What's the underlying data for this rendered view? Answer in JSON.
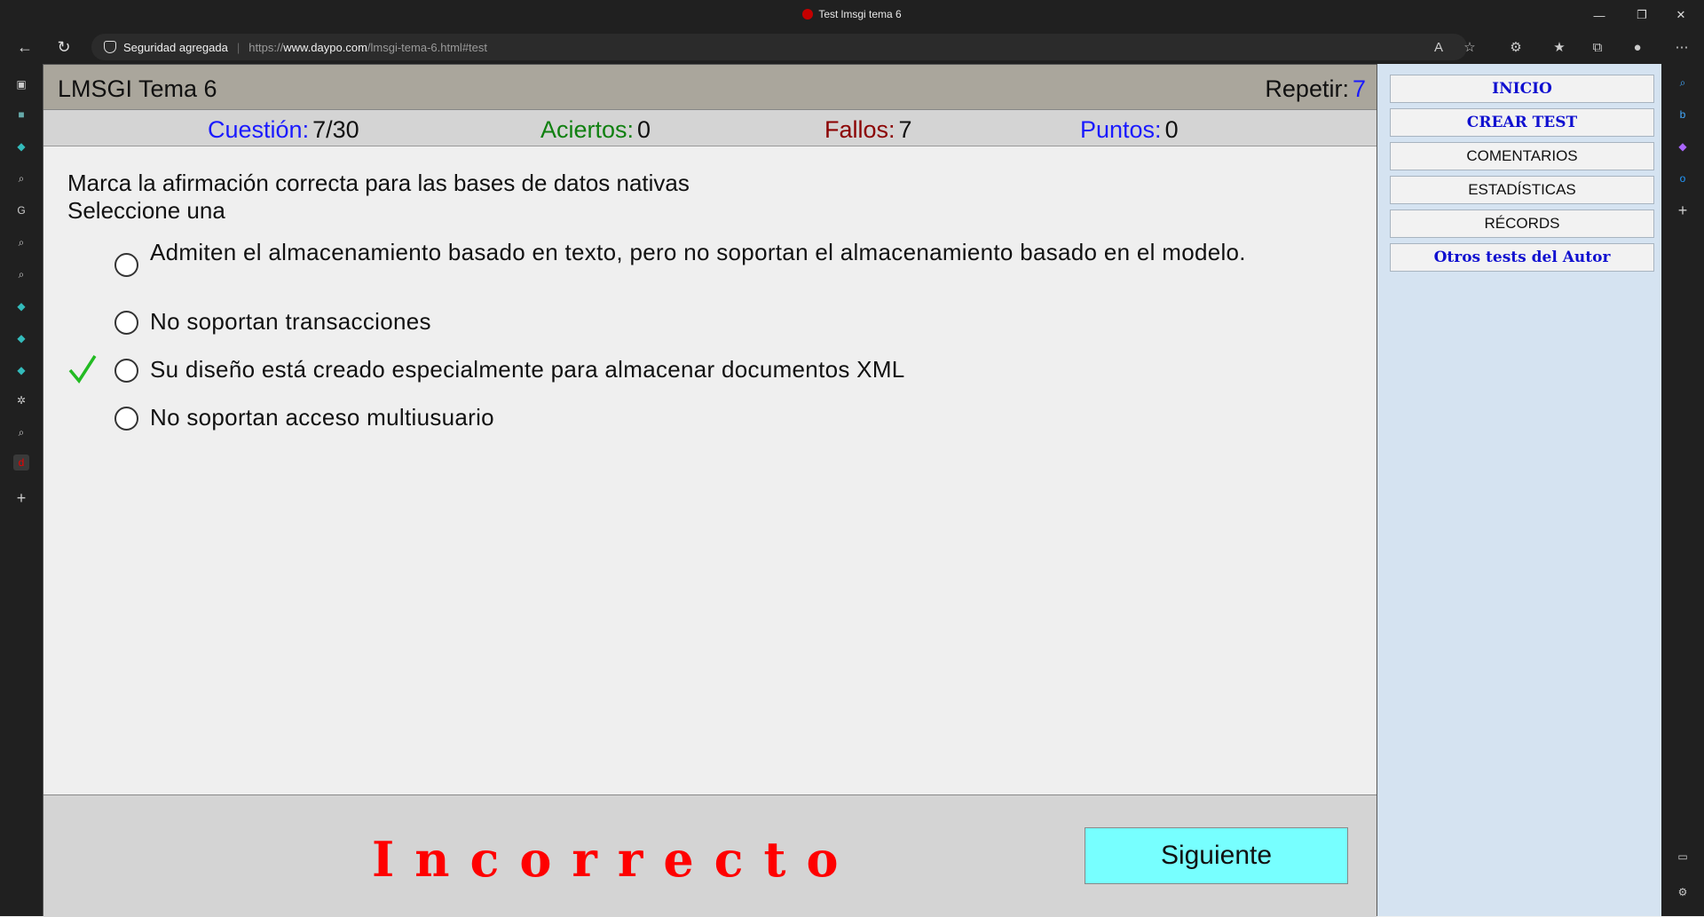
{
  "browser": {
    "window_title": "Test lmsgi tema 6",
    "security_label": "Seguridad agregada",
    "url_prefix": "https://",
    "url_domain": "www.daypo.com",
    "url_path": "/lmsgi-tema-6.html#test"
  },
  "quiz": {
    "title": "LMSGI Tema 6",
    "repeat_label": "Repetir:",
    "repeat_value": "7",
    "stats": {
      "question_label": "Cuestión:",
      "question_value": "7/30",
      "correct_label": "Aciertos:",
      "correct_value": "0",
      "errors_label": "Fallos:",
      "errors_value": "7",
      "points_label": "Puntos:",
      "points_value": "0"
    },
    "question": "Marca la afirmación correcta para las bases de datos nativas",
    "instruction": "Seleccione una",
    "options": [
      "Admiten el almacenamiento basado en texto, pero no soportan el almacenamiento basado en el modelo.",
      "No soportan transacciones",
      "Su diseño está creado especialmente para almacenar documentos XML",
      "No soportan acceso multiusuario"
    ],
    "correct_option_index": 2,
    "result": "Incorrecto",
    "next_label": "Siguiente"
  },
  "menu": [
    "INICIO",
    "CREAR TEST",
    "COMENTARIOS",
    "ESTADÍSTICAS",
    "RÉCORDS",
    "Otros tests del Autor"
  ],
  "colors": {
    "blue_label": "#1a1aff",
    "green_label": "#108010",
    "red_label": "#8b0000",
    "result_red": "#ff0000",
    "next_button": "#77ffff",
    "check_green": "#22bb22"
  }
}
